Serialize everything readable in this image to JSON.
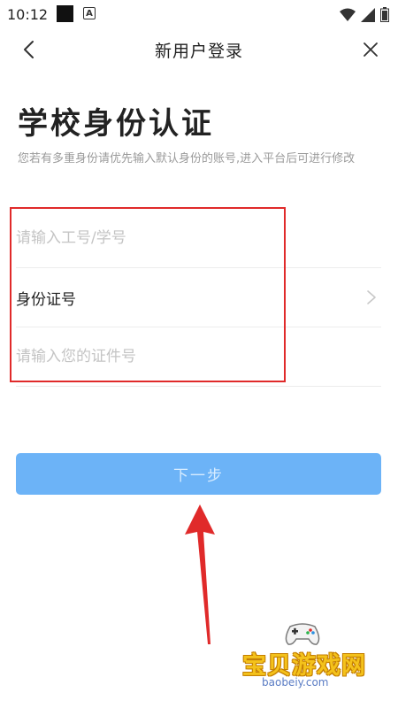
{
  "status_bar": {
    "time": "10:12",
    "notification_icons": [
      "black-square-icon",
      "a-icon"
    ],
    "right_icons": [
      "wifi-icon",
      "signal-icon",
      "battery-icon"
    ]
  },
  "nav": {
    "title": "新用户登录",
    "back_icon": "chevron-left-icon",
    "close_icon": "close-icon"
  },
  "page": {
    "title": "学校身份认证",
    "description": "您若有多重身份请优先输入默认身份的账号,进入平台后可进行修改"
  },
  "form": {
    "id_input": {
      "placeholder": "请输入工号/学号",
      "value": ""
    },
    "id_type_select": {
      "label": "身份证号",
      "icon": "chevron-right-icon"
    },
    "cert_input": {
      "placeholder": "请输入您的证件号",
      "value": ""
    }
  },
  "actions": {
    "next_label": "下一步"
  },
  "colors": {
    "primary_button": "#6cb3f7",
    "annotation_red": "#e02a2a",
    "placeholder": "#c4c4c4",
    "description": "#9a9a9a"
  },
  "watermark": {
    "title": "宝贝游戏网",
    "url": "baobeiy.com"
  }
}
